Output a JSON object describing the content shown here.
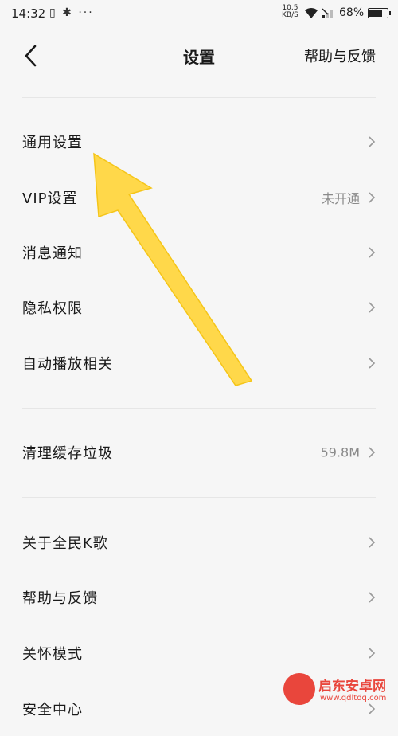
{
  "status_bar": {
    "time": "14:32",
    "left_icons": "▯ ✱ ···",
    "net_speed_value": "10.5",
    "net_speed_unit": "KB/S",
    "battery": "68%"
  },
  "header": {
    "title": "设置",
    "help_link": "帮助与反馈"
  },
  "settings": {
    "general": {
      "label": "通用设置",
      "value": ""
    },
    "vip": {
      "label": "VIP设置",
      "value": "未开通"
    },
    "notifications": {
      "label": "消息通知",
      "value": ""
    },
    "privacy": {
      "label": "隐私权限",
      "value": ""
    },
    "autoplay": {
      "label": "自动播放相关",
      "value": ""
    },
    "cache": {
      "label": "清理缓存垃圾",
      "value": "59.8M"
    },
    "about": {
      "label": "关于全民K歌",
      "value": ""
    },
    "help": {
      "label": "帮助与反馈",
      "value": ""
    },
    "care_mode": {
      "label": "关怀模式",
      "value": ""
    },
    "security": {
      "label": "安全中心",
      "value": ""
    }
  },
  "annotation": {
    "arrow_color": "#ffd84a"
  },
  "watermark": {
    "brand": "启东安卓网",
    "url": "www.qdltdq.com",
    "color": "#e9463c"
  }
}
